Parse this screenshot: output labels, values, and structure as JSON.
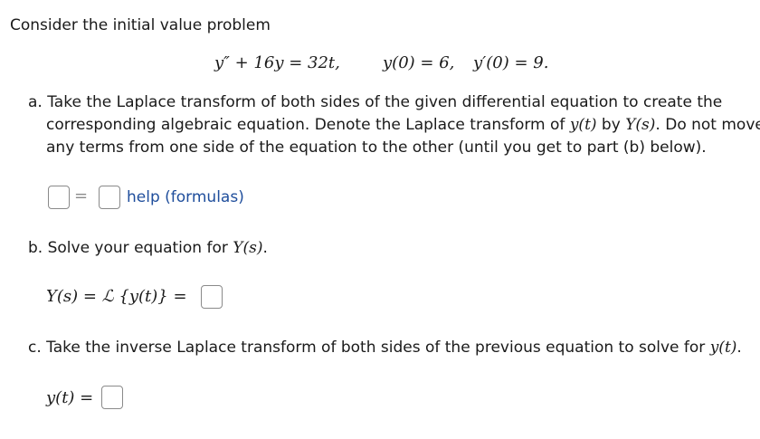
{
  "intro": "Consider the initial value problem",
  "problem": {
    "ode": "y″ + 16y = 32t,",
    "ic1": "y(0) = 6,",
    "ic2": "y′(0) = 9."
  },
  "part_a": {
    "line1": "a. Take the Laplace transform of both sides of the given differential equation to create the",
    "line2_pre": "corresponding algebraic equation. Denote the Laplace transform of ",
    "line2_yt": "y(t)",
    "line2_mid": " by ",
    "line2_Ys": "Y(s)",
    "line2_post": ". Do not move",
    "line3": "any terms from one side of the equation to the other (until you get to part (b) below).",
    "equals": "=",
    "help_link": "help (formulas)"
  },
  "part_b": {
    "text_pre": "b. Solve your equation for ",
    "text_Ys": "Y(s)",
    "text_post": ".",
    "expr": "Y(s) = ℒ {y(t)} ="
  },
  "part_c": {
    "text_pre": "c. Take the inverse Laplace transform of both sides of the previous equation to solve for ",
    "text_yt": "y(t)",
    "text_post": ".",
    "expr": "y(t) ="
  }
}
